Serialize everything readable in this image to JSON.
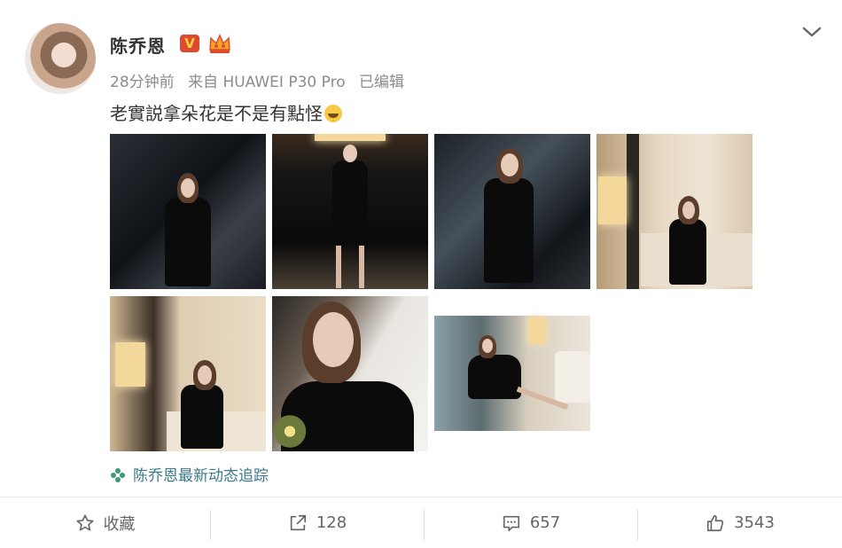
{
  "post": {
    "author": "陈乔恩",
    "time": "28分钟前",
    "source": "来自 HUAWEI P30 Pro",
    "edited": "已编辑",
    "text": "老實説拿朵花是不是有點怪",
    "emoji": "grinning-face-emoji",
    "verified_badge": "V",
    "follow_link": "陈乔恩最新动态追踪"
  },
  "actions": {
    "favorite": "收藏",
    "repost": "128",
    "comment": "657",
    "like": "3543"
  },
  "colors": {
    "badge_bg": "#e0482f",
    "badge_text": "#ffd23f",
    "follow_link": "#3c7a8a",
    "muted_text": "#8c8c8c"
  },
  "icons": {
    "dropdown": "chevron-down-icon",
    "favorite": "star-icon",
    "repost": "share-arrow-icon",
    "comment": "comment-icon",
    "like": "thumbs-up-icon",
    "follow": "flower-icon",
    "membership": "crown-icon"
  }
}
